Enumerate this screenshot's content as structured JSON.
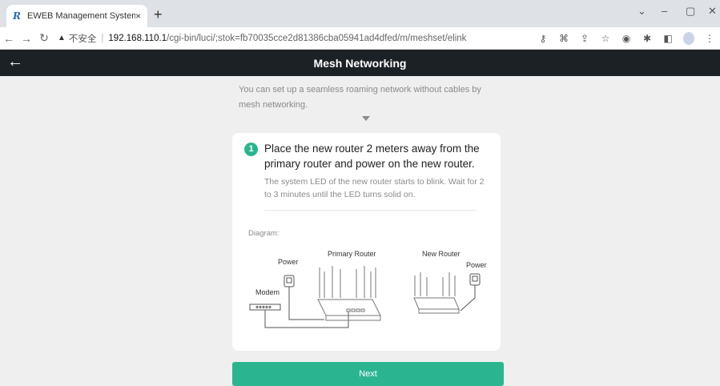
{
  "browser": {
    "tab_favicon": "R",
    "tab_title": "EWEB Management System",
    "tab_close": "×",
    "new_tab": "+",
    "url_warning": "▲",
    "url_insecure": "不安全",
    "url_separator": "|",
    "url_host": "192.168.110.1",
    "url_path": "/cgi-bin/luci/;stok=fb70035cce2d81386cba05941ad4dfed/m/meshset/elink"
  },
  "header": {
    "back_label": "←",
    "title": "Mesh Networking"
  },
  "main": {
    "intro": "You can set up a seamless roaming network without cables by mesh networking.",
    "step": {
      "number": "1",
      "title": "Place the new router 2 meters away from the primary router and power on the new router.",
      "description": "The system LED of the new router starts to blink. Wait for 2 to 3 minutes until the LED turns solid on."
    },
    "diagram": {
      "label": "Diagram:",
      "primary_router": "Primary Router",
      "new_router": "New Router",
      "power_left": "Power",
      "power_right": "Power",
      "modem": "Modem"
    },
    "next_label": "Next"
  },
  "colors": {
    "accent": "#2bb58f",
    "header_bg": "#1c2126",
    "page_bg": "#efefef"
  }
}
